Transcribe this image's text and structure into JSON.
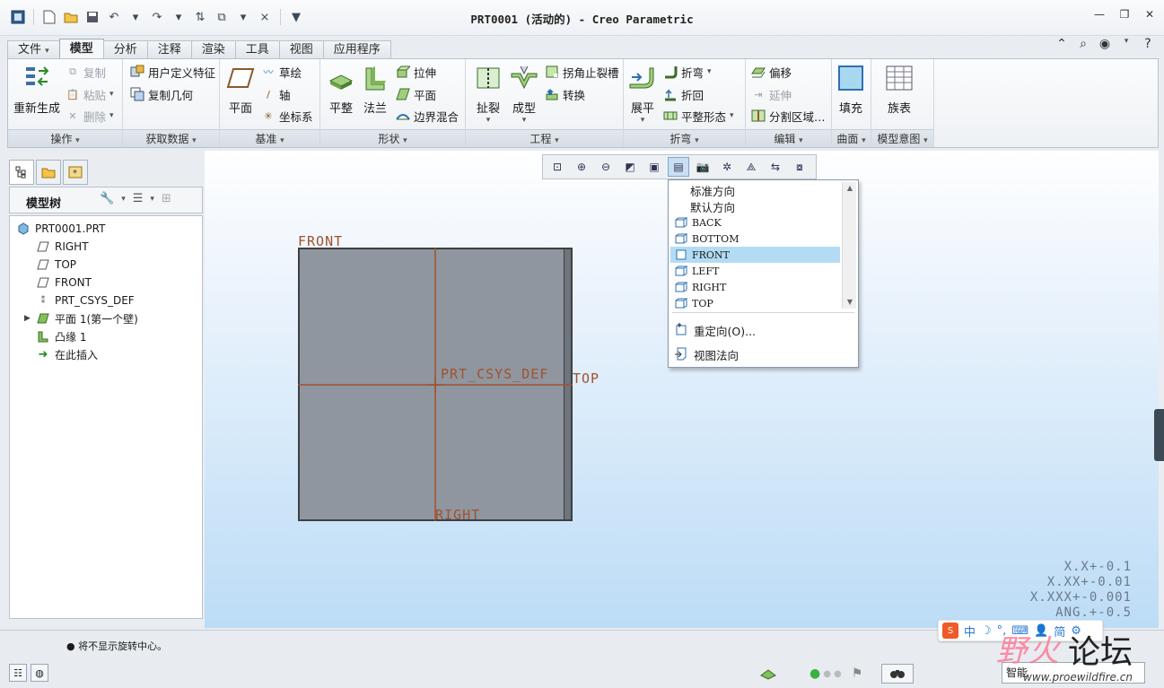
{
  "window": {
    "title": "PRT0001 (活动的) - Creo Parametric"
  },
  "ribbon_tabs": [
    "文件",
    "模型",
    "分析",
    "注释",
    "渲染",
    "工具",
    "视图",
    "应用程序"
  ],
  "ribbon": {
    "operations": {
      "label": "操作",
      "regenerate": "重新生成",
      "copy": "复制",
      "paste": "粘贴",
      "delete": "删除"
    },
    "get_data": {
      "label": "获取数据",
      "udf": "用户定义特征",
      "copy_geom": "复制几何"
    },
    "datum": {
      "label": "基准",
      "plane": "平面",
      "sketch": "草绘",
      "axis": "轴",
      "csys": "坐标系"
    },
    "shape": {
      "label": "形状",
      "flat": "平整",
      "flange": "法兰",
      "extrude": "拉伸",
      "plane": "平面",
      "boundary_blend": "边界混合"
    },
    "engineering": {
      "label": "工程",
      "rip": "扯裂",
      "form": "成型",
      "corner_relief": "拐角止裂槽",
      "convert": "转换"
    },
    "bend": {
      "label": "折弯",
      "unbend": "展平",
      "bend": "折弯",
      "bend_back": "折回",
      "flat_state": "平整形态"
    },
    "edit": {
      "label": "编辑",
      "offset": "偏移",
      "extend": "延伸",
      "split_area": "分割区域…"
    },
    "surface": {
      "label": "曲面",
      "fill": "填充"
    },
    "model_intent": {
      "label": "模型意图",
      "family_table": "族表"
    }
  },
  "model_tree": {
    "title": "模型树",
    "items": [
      {
        "label": "PRT0001.PRT",
        "icon": "part-icon"
      },
      {
        "label": "RIGHT",
        "icon": "datum-plane-icon"
      },
      {
        "label": "TOP",
        "icon": "datum-plane-icon"
      },
      {
        "label": "FRONT",
        "icon": "datum-plane-icon"
      },
      {
        "label": "PRT_CSYS_DEF",
        "icon": "csys-icon"
      },
      {
        "label": "平面 1(第一个壁)",
        "icon": "flat-wall-icon"
      },
      {
        "label": "凸缘 1",
        "icon": "flange-icon"
      },
      {
        "label": "在此插入",
        "icon": "insert-here-arrow-icon"
      }
    ]
  },
  "saved_orientations": {
    "standard": "标准方向",
    "default": "默认方向",
    "views": [
      "BACK",
      "BOTTOM",
      "FRONT",
      "LEFT",
      "RIGHT",
      "TOP"
    ],
    "selected": "FRONT",
    "reorient": "重定向(O)...",
    "view_normal": "视图法向"
  },
  "graphics": {
    "datum_labels": {
      "front": "FRONT",
      "csys": "PRT_CSYS_DEF",
      "top": "TOP",
      "right": "RIGHT"
    },
    "tolerances": [
      "X.X+-0.1",
      "X.XX+-0.01",
      "X.XXX+-0.001",
      "ANG.+-0.5"
    ]
  },
  "status": {
    "message": "将不显示旋转中心。",
    "filter": "智能"
  },
  "ime": {
    "mode": "中",
    "label": "简"
  },
  "watermark": {
    "text1": "野火",
    "text2": "论坛",
    "url": "www.proewildfire.cn"
  },
  "colors": {
    "datum": "#a0522d",
    "selection": "#b3dcf4",
    "model_fill": "#8f969f"
  }
}
